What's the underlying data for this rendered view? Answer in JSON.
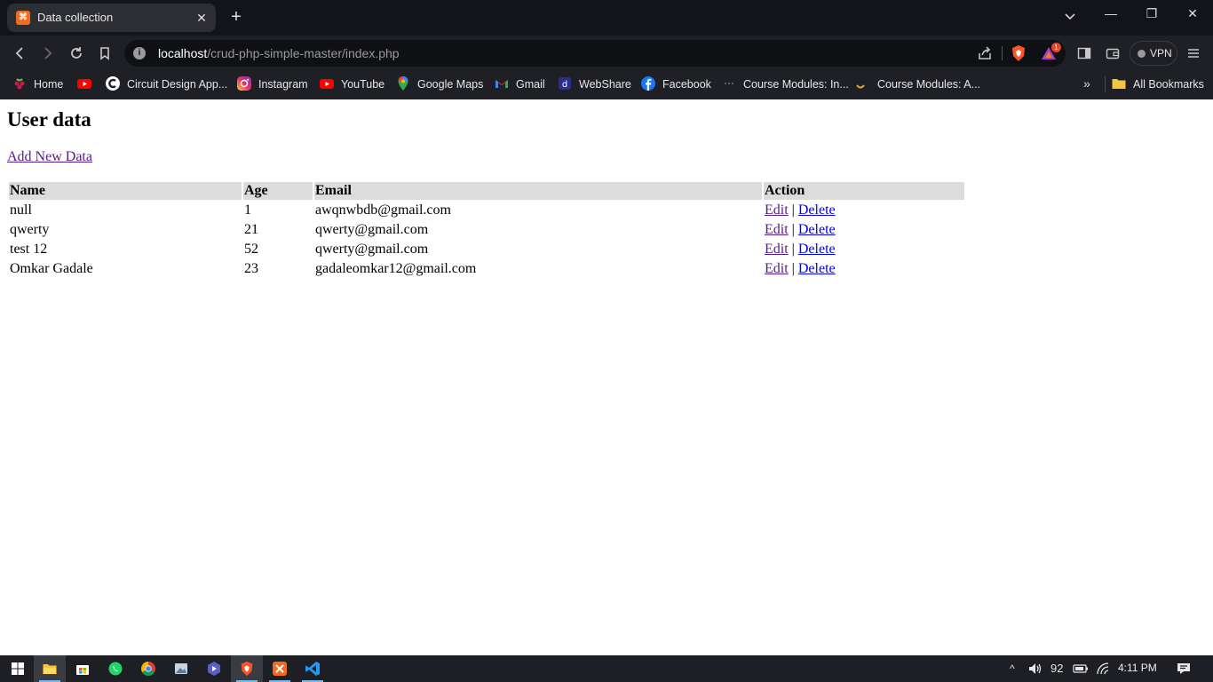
{
  "browser": {
    "tab_title": "Data collection",
    "tab_favicon_glyph": "⌘",
    "new_tab_glyph": "+",
    "close_glyph": "✕",
    "url_host": "localhost",
    "url_path": "/crud-php-simple-master/index.php",
    "rewards_badge": "1",
    "vpn_label": "VPN",
    "window": {
      "minimize": "—",
      "restore": "❐",
      "close": "✕"
    },
    "bookmarks": [
      {
        "label": "Home",
        "icon": "raspberry-icon"
      },
      {
        "label": "",
        "icon": "youtube-icon"
      },
      {
        "label": "Circuit Design App...",
        "icon": "circuit-icon"
      },
      {
        "label": "Instagram",
        "icon": "instagram-icon"
      },
      {
        "label": "YouTube",
        "icon": "youtube-icon"
      },
      {
        "label": "Google Maps",
        "icon": "maps-icon"
      },
      {
        "label": "Gmail",
        "icon": "gmail-icon"
      },
      {
        "label": "WebShare",
        "icon": "webshare-icon"
      },
      {
        "label": "Facebook",
        "icon": "facebook-icon"
      },
      {
        "label": "Course Modules: In...",
        "icon": "dots-icon"
      },
      {
        "label": "Course Modules: A...",
        "icon": "course-icon"
      }
    ],
    "bookmarks_more": "»",
    "all_bookmarks": "All Bookmarks"
  },
  "page": {
    "heading": "User data",
    "add_link": "Add New Data",
    "table": {
      "headers": [
        "Name",
        "Age",
        "Email",
        "Action"
      ],
      "rows": [
        {
          "name": "null",
          "age": "1",
          "email": "awqnwbdb@gmail.com"
        },
        {
          "name": "qwerty",
          "age": "21",
          "email": "qwerty@gmail.com"
        },
        {
          "name": "test 12",
          "age": "52",
          "email": "qwerty@gmail.com"
        },
        {
          "name": "Omkar Gadale",
          "age": "23",
          "email": "gadaleomkar12@gmail.com"
        }
      ],
      "edit_label": "Edit",
      "separator": "|",
      "delete_label": "Delete"
    }
  },
  "taskbar": {
    "tray_expand": "^",
    "volume": "92",
    "time": "4:11 PM"
  },
  "colors": {
    "tab_bar": "#131419",
    "toolbar": "#1f2025",
    "table_header": "#dcdcdc",
    "visited_link": "#551a8b",
    "link": "#0000ee",
    "taskbar": "#1d1f24"
  }
}
